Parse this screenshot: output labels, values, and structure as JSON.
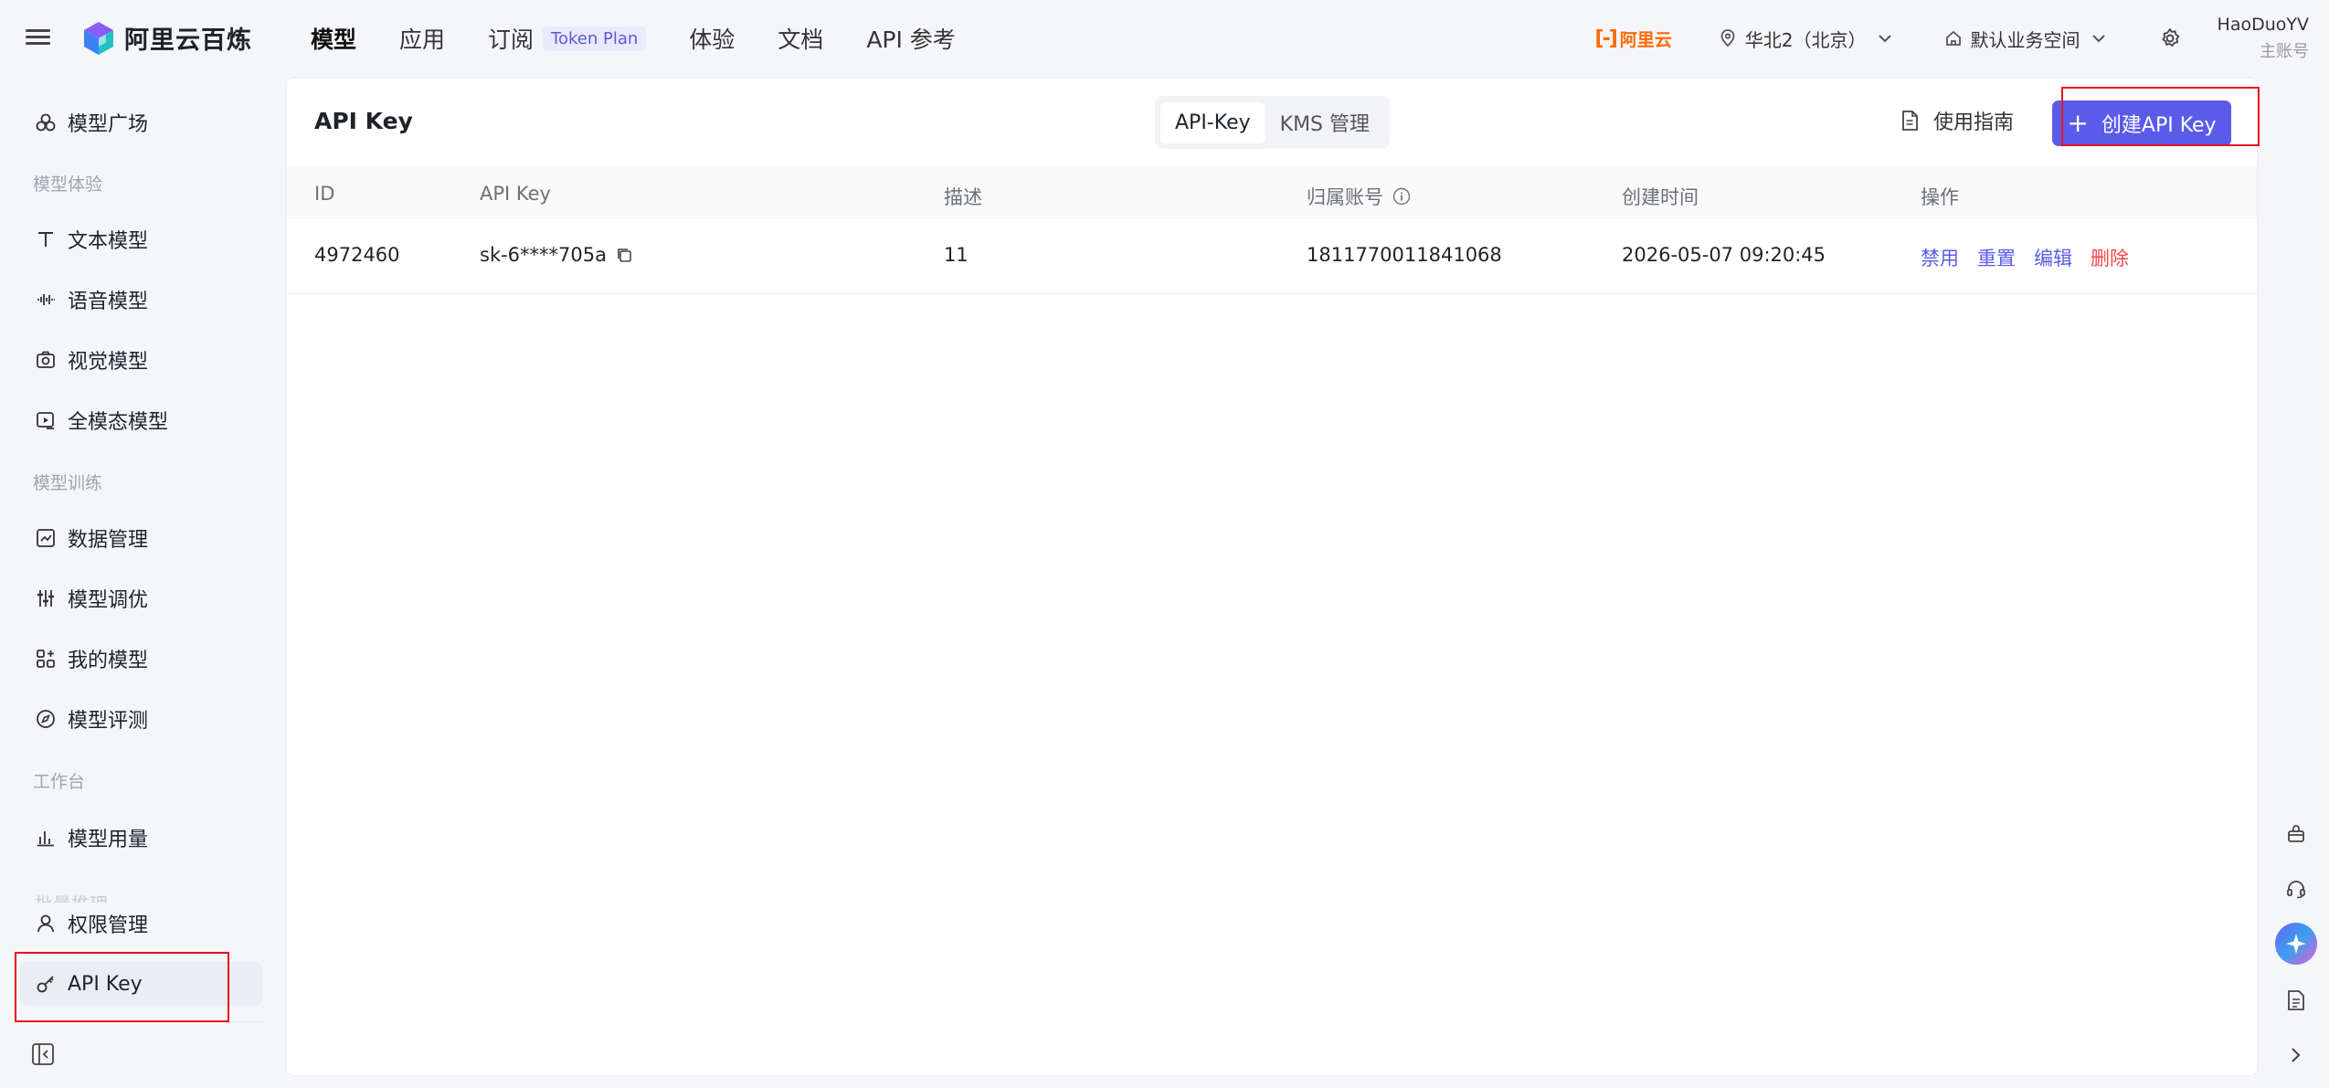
{
  "brand": {
    "name": "阿里云百炼"
  },
  "topnav": {
    "items": [
      {
        "label": "模型"
      },
      {
        "label": "应用"
      },
      {
        "label": "订阅",
        "badge": "Token Plan"
      },
      {
        "label": "体验"
      },
      {
        "label": "文档"
      },
      {
        "label": "API 参考"
      }
    ]
  },
  "header": {
    "aliyun_logo": "阿里云",
    "region": "华北2（北京）",
    "workspace": "默认业务空间",
    "user_name": "HaoDuoYV",
    "user_role": "主账号"
  },
  "sidebar": {
    "model_square": "模型广场",
    "group_experience": "模型体验",
    "text_model": "文本模型",
    "voice_model": "语音模型",
    "vision_model": "视觉模型",
    "omni_model": "全模态模型",
    "group_training": "模型训练",
    "data_management": "数据管理",
    "model_tuning": "模型调优",
    "my_models": "我的模型",
    "model_eval": "模型评测",
    "group_workbench": "工作台",
    "model_usage": "模型用量",
    "faded_item": "批量推理",
    "permissions": "权限管理",
    "api_key": "API Key"
  },
  "panel": {
    "title": "API Key",
    "tabs": [
      "API-Key",
      "KMS 管理"
    ],
    "guide": "使用指南",
    "create_button": "创建API Key"
  },
  "table": {
    "headers": [
      "ID",
      "API Key",
      "描述",
      "归属账号",
      "创建时间",
      "操作"
    ],
    "rows": [
      {
        "id": "4972460",
        "api_key": "sk-6****705a",
        "desc": "11",
        "account": "1811770011841068",
        "created": "2026-05-07 09:20:45",
        "actions": [
          "禁用",
          "重置",
          "编辑",
          "删除"
        ]
      }
    ]
  },
  "colors": {
    "accent": "#5b5bea",
    "danger": "#f5484d",
    "brand_orange": "#ff6a00",
    "annotation_red": "#e8121f"
  }
}
